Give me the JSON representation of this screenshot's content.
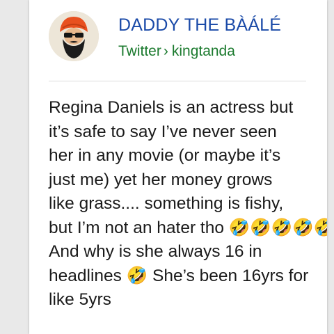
{
  "profile": {
    "name": "DADDY THE BÀÁLÉ",
    "source_site": "Twitter",
    "separator": "›",
    "handle": "kingtanda",
    "avatar_icon": "bearded-man-turban-avatar-icon"
  },
  "post": {
    "lines": [
      "Regina Daniels is an actress but",
      "it’s safe to say I’ve never seen",
      "her in any movie (or maybe it’s",
      "just me) yet her money grows",
      "like grass.... something is fishy,",
      "but I’m not an hater tho 🤣🤣🤣🤣🤣🤣",
      "And why is she always 16 in",
      "headlines 🤣 She’s been 16yrs for",
      "like 5yrs"
    ]
  },
  "colors": {
    "name": "#1a4aa8",
    "source": "#1b7a2e",
    "text": "#1a1a1a",
    "card": "#ffffff"
  }
}
